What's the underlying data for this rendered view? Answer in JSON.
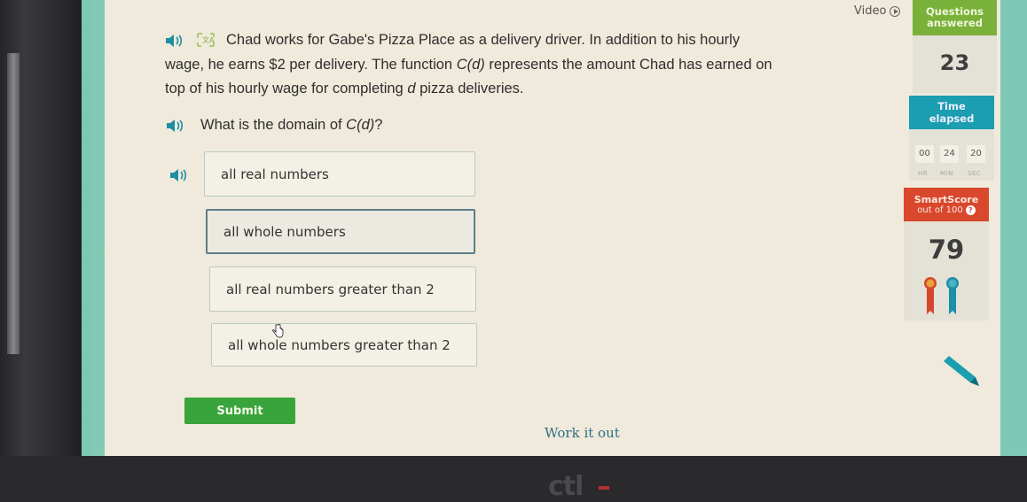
{
  "header": {
    "video_label": "Video",
    "video_icon": "play-circle-icon"
  },
  "sidebar": {
    "questions_answered_label_line1": "Questions",
    "questions_answered_label_line2": "answered",
    "questions_answered_value": "23",
    "time_elapsed_label_line1": "Time",
    "time_elapsed_label_line2": "elapsed",
    "timer": {
      "hours": "00",
      "minutes": "24",
      "seconds": "20",
      "hours_label": "HR",
      "minutes_label": "MIN",
      "seconds_label": "SEC"
    },
    "smartscore_title": "SmartScore",
    "smartscore_sub": "out of 100",
    "smartscore_help_icon": "?",
    "smartscore_value": "79",
    "awards": [
      "red-ribbon",
      "blue-ribbon"
    ],
    "colors": {
      "questions_answered": "#7ab13a",
      "time_elapsed": "#1a9eb0",
      "smartscore": "#d9472c"
    }
  },
  "question": {
    "lines": [
      "Chad works for Gabe's Pizza Place as a delivery driver. In addition to his hourly",
      "wage, he earns $2 per delivery. The function",
      "represents the amount Chad has earned on",
      "top of his hourly wage for completing",
      "pizza deliveries."
    ],
    "function_name": "C(d)",
    "variable": "d",
    "prompt_prefix": "What is the domain of",
    "prompt_suffix": "?"
  },
  "choices": [
    {
      "label": "all real numbers",
      "selected": false
    },
    {
      "label": "all whole numbers",
      "selected": true
    },
    {
      "label": "all real numbers greater than 2",
      "selected": false
    },
    {
      "label": "all whole numbers greater than 2",
      "selected": false
    }
  ],
  "actions": {
    "submit_label": "Submit",
    "work_it_out_label": "Work it out"
  },
  "monitor": {
    "brand": "ctl"
  }
}
